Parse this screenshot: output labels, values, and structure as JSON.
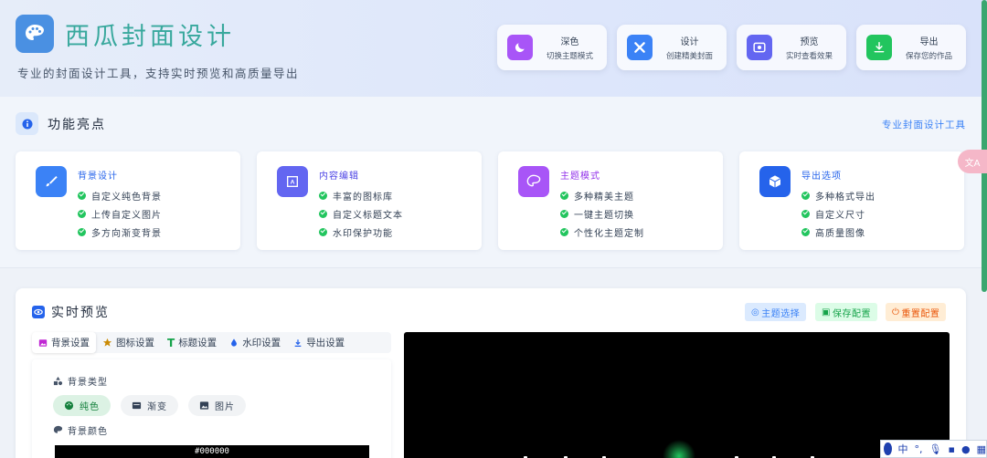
{
  "header": {
    "title": "西瓜封面设计",
    "subtitle": "专业的封面设计工具，支持实时预览和高质量导出",
    "buttons": [
      {
        "label": "深色",
        "desc": "切换主题模式",
        "icon": "moon-icon",
        "color": "#a855f7"
      },
      {
        "label": "设计",
        "desc": "创建精美封面",
        "icon": "tools-icon",
        "color": "#3b82f6"
      },
      {
        "label": "预览",
        "desc": "实时查看效果",
        "icon": "eye-icon",
        "color": "#6366f1"
      },
      {
        "label": "导出",
        "desc": "保存您的作品",
        "icon": "download-icon",
        "color": "#22c55e"
      }
    ]
  },
  "features": {
    "title": "功能亮点",
    "link": "专业封面设计工具",
    "cards": [
      {
        "title": "背景设计",
        "icon": "brush-icon",
        "color": "#3b82f6",
        "items": [
          "自定义纯色背景",
          "上传自定义图片",
          "多方向渐变背景"
        ]
      },
      {
        "title": "内容编辑",
        "icon": "text-frame-icon",
        "color": "#6366f1",
        "items": [
          "丰富的图标库",
          "自定义标题文本",
          "水印保护功能"
        ]
      },
      {
        "title": "主题模式",
        "icon": "palette-icon",
        "color": "#a855f7",
        "items": [
          "多种精美主题",
          "一键主题切换",
          "个性化主题定制"
        ]
      },
      {
        "title": "导出选项",
        "icon": "cube-icon",
        "color": "#2563eb",
        "items": [
          "多种格式导出",
          "自定义尺寸",
          "高质量图像"
        ]
      }
    ]
  },
  "preview": {
    "title": "实时预览",
    "actions": [
      {
        "label": "主题选择",
        "color": "#3b82f6",
        "bg": "#dbeafe"
      },
      {
        "label": "保存配置",
        "color": "#16a34a",
        "bg": "#dcfce7"
      },
      {
        "label": "重置配置",
        "color": "#ea580c",
        "bg": "#ffedd5"
      }
    ],
    "tabs": [
      "背景设置",
      "图标设置",
      "标题设置",
      "水印设置",
      "导出设置"
    ],
    "panel": {
      "bg_type_label": "背景类型",
      "options": [
        "纯色",
        "渐变",
        "图片"
      ],
      "bg_color_label": "背景颜色",
      "bg_color_value": "#000000"
    }
  },
  "ime": {
    "lang": "中"
  }
}
